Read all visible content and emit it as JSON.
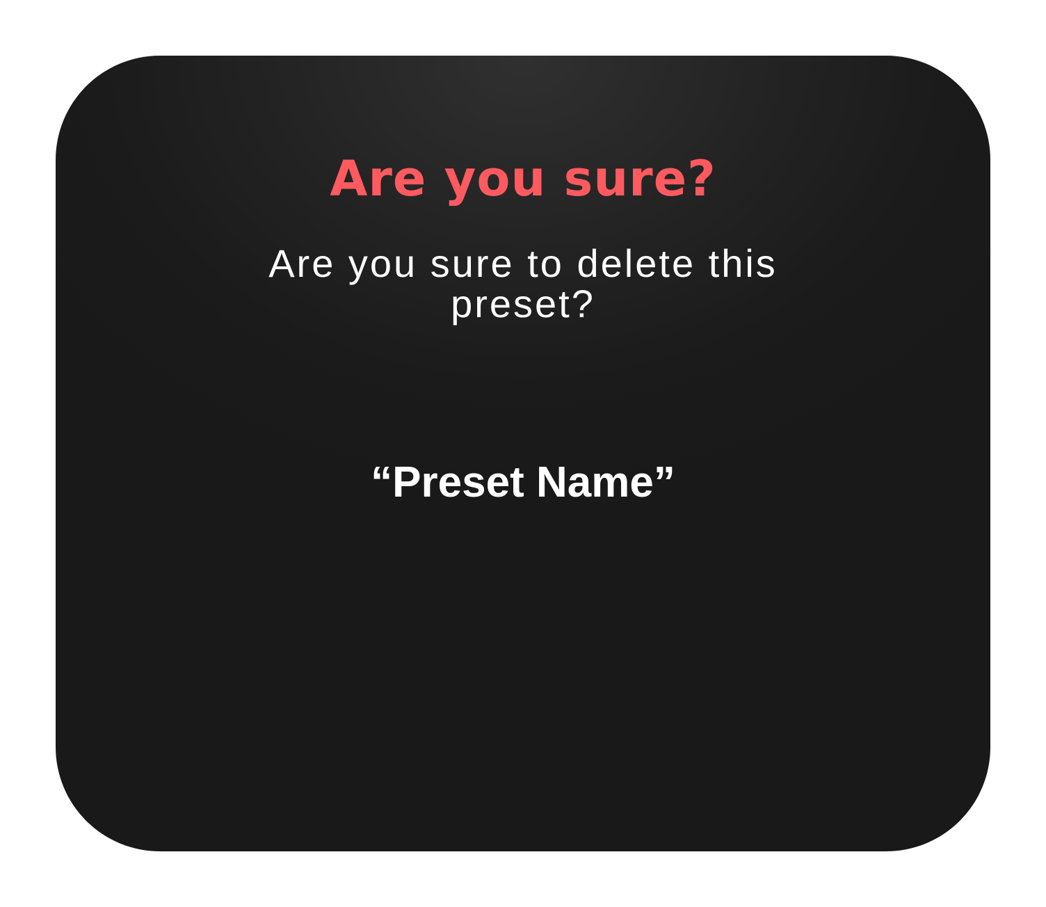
{
  "dialog": {
    "title": "Are you sure?",
    "message": "Are you sure to delete this preset?",
    "preset_name": "“Preset Name”"
  },
  "colors": {
    "page_background": "#ffffff",
    "dialog_background": "#1c1c1c",
    "title_accent": "#ff5a5f",
    "text_primary": "#ffffff"
  }
}
